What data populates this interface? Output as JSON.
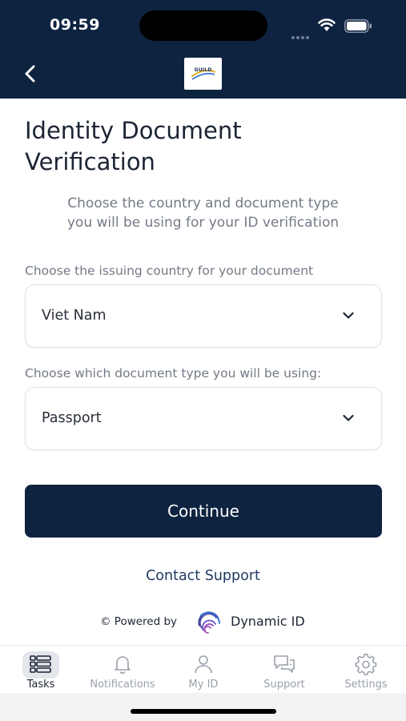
{
  "status_bar": {
    "time": "09:59"
  },
  "header": {
    "logo_text": "GUILD"
  },
  "page": {
    "title_line1": "Identity Document",
    "title_line2": "Verification",
    "subtitle_line1": "Choose the country and document type",
    "subtitle_line2": "you will be using for your ID verification"
  },
  "form": {
    "country_label": "Choose the issuing country for your document",
    "country_value": "Viet Nam",
    "doctype_label": "Choose which document type you will be using:",
    "doctype_value": "Passport"
  },
  "actions": {
    "continue_label": "Continue",
    "contact_label": "Contact Support"
  },
  "footer": {
    "powered_by": "© Powered by",
    "brand": "Dynamic ID"
  },
  "tabbar": {
    "active": "Tasks",
    "items": [
      {
        "label": "Tasks",
        "icon": "tasks-icon"
      },
      {
        "label": "Notifications",
        "icon": "bell-icon"
      },
      {
        "label": "My ID",
        "icon": "person-icon"
      },
      {
        "label": "Support",
        "icon": "chat-icon"
      },
      {
        "label": "Settings",
        "icon": "gear-icon"
      }
    ]
  },
  "colors": {
    "header_bg": "#0e2340",
    "button_bg": "#0e2340",
    "muted_text": "#737a86",
    "link": "#1e3a5f"
  }
}
